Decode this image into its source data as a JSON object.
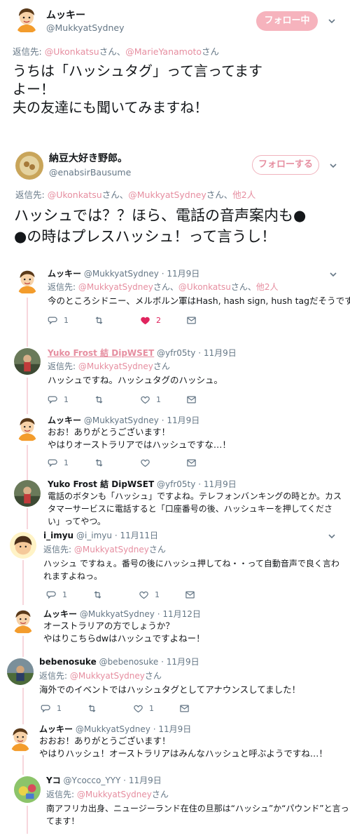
{
  "main": {
    "name": "ムッキー",
    "handle": "@MukkyatSydney",
    "follow_label": "フォロー中",
    "reply_prefix": "返信先:",
    "reply_to_1": "@Ukonkatsu",
    "reply_sep_1": "さん、",
    "reply_to_2": "@MarieYanamoto",
    "reply_sep_2": "さん",
    "text_1": "うちは「ハッシュタグ」って言ってます",
    "text_2": "よー！",
    "text_3": "夫の友達にも聞いてみますね！"
  },
  "second": {
    "name": "納豆大好き野郎。",
    "handle": "@enabsirBausume",
    "follow_label": "フォローする",
    "reply_prefix": "返信先:",
    "reply_to_1": "@Ukonkatsu",
    "reply_sep_1": "さん、",
    "reply_to_2": "@MukkyatSydney",
    "reply_sep_2": "さん、",
    "reply_more": "他2人",
    "text_1": "ハッシュでは？？ほら、電話の音声案内も●",
    "text_2": "●の時はプレスハッシュ！って言うし！"
  },
  "replies": [
    {
      "name": "ムッキー",
      "handle": "@MukkyatSydney",
      "date": "11月9日",
      "reply_prefix": "返信先:",
      "reply_to_1": "@MukkyatSydney",
      "reply_sep_1": "さん、",
      "reply_to_2": "@Ukonkatsu",
      "reply_sep_2": "さん、",
      "reply_more": "他2人",
      "text": "今のところシドニー、メルボルン軍はHash, hash sign, hush tagだそうです！",
      "reply_count": "1",
      "like_count": "2"
    },
    {
      "name": "Yuko Frost 結 DipWSET",
      "handle": "@yfr05ty",
      "date": "11月9日",
      "reply_prefix": "返信先:",
      "reply_to_1": "@MukkyatSydney",
      "reply_sep_1": "さん",
      "text": "ハッシュですね。ハッシュタグのハッシュ。",
      "reply_count": "1",
      "like_count": "1"
    },
    {
      "name": "ムッキー",
      "handle": "@MukkyatSydney",
      "date": "11月9日",
      "text_1": "おお！ありがとうございます！",
      "text_2": "やはりオーストラリアではハッシュですな…！",
      "reply_count": "1"
    },
    {
      "name": "Yuko Frost 結 DipWSET",
      "handle": "@yfr05ty",
      "date": "11月9日",
      "text_1": "電話のボタンも「ハッシュ」ですよね。テレフォンバンキングの時とか。カス",
      "text_2": "タマーサービスに電話すると「口座番号の後、ハッシュキーを押してくださ",
      "text_3": "い」ってやつ。"
    },
    {
      "name": "i_imyu",
      "handle": "@i_imyu",
      "date": "11月11日",
      "reply_prefix": "返信先:",
      "reply_to_1": "@MukkyatSydney",
      "reply_sep_1": "さん",
      "text_1": "ハッシュ ですねぇ。番号の後にハッシュ押してね・・って自動音声で良く言わ",
      "text_2": "れますよねっ。",
      "reply_count": "1",
      "like_count": "1"
    },
    {
      "name": "ムッキー",
      "handle": "@MukkyatSydney",
      "date": "11月12日",
      "text_1": "オーストラリアの方でしょうか？",
      "text_2": "やはりこちらdwはハッシュですよねー！"
    },
    {
      "name": "bebenosuke",
      "handle": "@bebenosuke",
      "date": "11月9日",
      "reply_prefix": "返信先:",
      "reply_to_1": "@MukkyatSydney",
      "reply_sep_1": "さん",
      "text": "海外でのイベントではハッシュタグとしてアナウンスしてました！",
      "reply_count": "1",
      "like_count": "1"
    },
    {
      "name": "ムッキー",
      "handle": "@MukkyatSydney",
      "date": "11月9日",
      "text_1": "おおお！ありがとうございます！",
      "text_2": "やはりハッシュ！オーストラリアはみんなハッシュと呼ぶようですね…！"
    },
    {
      "name": "Yコ",
      "handle": "@Ycocco_YYY",
      "date": "11月9日",
      "reply_prefix": "返信先:",
      "reply_to_1": "@MukkyatSydney",
      "reply_sep_1": "さん",
      "text_1": "南アフリカ出身、ニュージーランド在住の旦那は“ハッシュ”か“パウンド”と言っ",
      "text_2": "てます！"
    }
  ],
  "icons": {
    "reply": "reply-icon",
    "retweet": "retweet-icon",
    "like": "heart-icon",
    "dm": "envelope-icon",
    "more": "chevron-down-icon"
  },
  "colors": {
    "accent": "#e68ea0",
    "follow_bg": "#f6b3bd",
    "thread": "#f7d6dc",
    "liked": "#e0245e"
  }
}
